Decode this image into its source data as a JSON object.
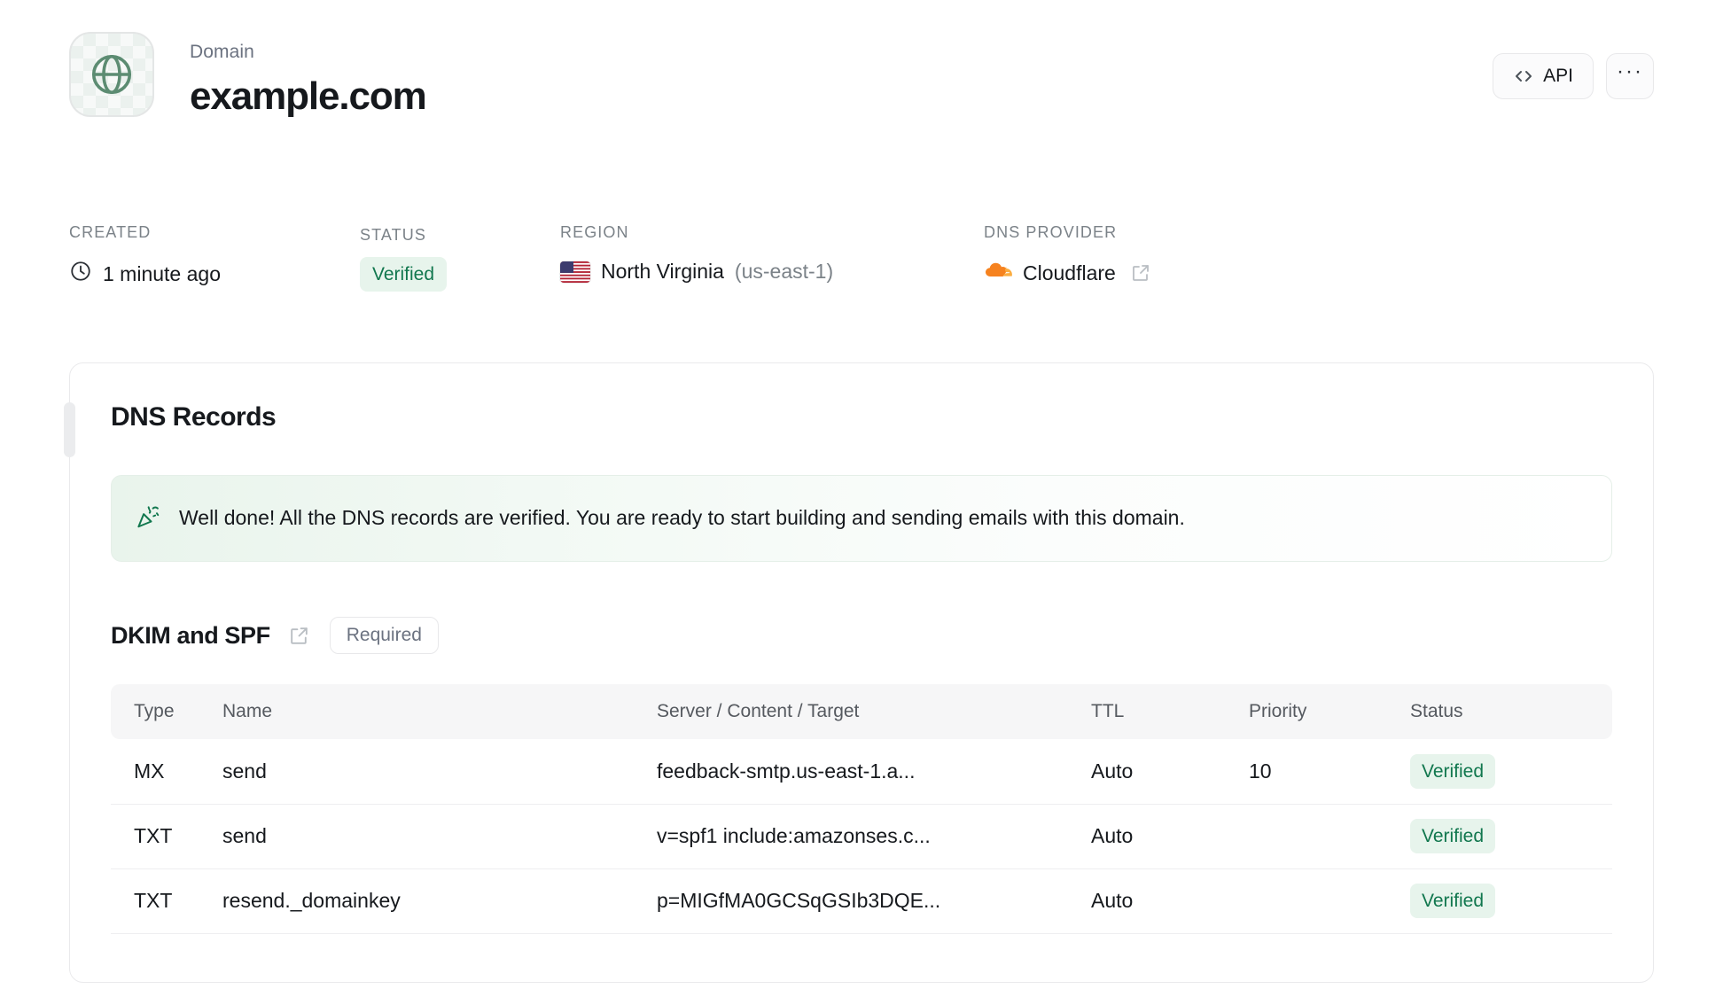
{
  "header": {
    "eyebrow": "Domain",
    "title": "example.com",
    "tile_icon": "globe-icon",
    "api_button": "API",
    "api_icon": "code-icon",
    "more_button": "···"
  },
  "meta": {
    "created": {
      "label": "CREATED",
      "icon": "clock-icon",
      "value": "1 minute ago"
    },
    "status": {
      "label": "STATUS",
      "value": "Verified"
    },
    "region": {
      "label": "REGION",
      "icon": "us-flag-icon",
      "value": "North Virginia",
      "code": "(us-east-1)"
    },
    "dns_provider": {
      "label": "DNS PROVIDER",
      "icon": "cloudflare-icon",
      "value": "Cloudflare",
      "link_icon": "external-link-icon"
    }
  },
  "card": {
    "title": "DNS Records",
    "notice": {
      "icon": "party-popper-icon",
      "text": "Well done! All the DNS records are verified. You are ready to start building and sending emails with this domain."
    },
    "section": {
      "title": "DKIM and SPF",
      "link_icon": "external-link-icon",
      "badge": "Required"
    },
    "table": {
      "columns": [
        "Type",
        "Name",
        "Server / Content / Target",
        "TTL",
        "Priority",
        "Status"
      ],
      "rows": [
        {
          "type": "MX",
          "name": "send",
          "target": "feedback-smtp.us-east-1.a...",
          "ttl": "Auto",
          "priority": "10",
          "status": "Verified"
        },
        {
          "type": "TXT",
          "name": "send",
          "target": "v=spf1 include:amazonses.c...",
          "ttl": "Auto",
          "priority": "",
          "status": "Verified"
        },
        {
          "type": "TXT",
          "name": "resend._domainkey",
          "target": "p=MIGfMA0GCSqGSIb3DQE...",
          "ttl": "Auto",
          "priority": "",
          "status": "Verified"
        }
      ]
    }
  },
  "colors": {
    "accent_green": "#11774e",
    "badge_bg": "#e7f4ec",
    "cloudflare_orange": "#f6821f",
    "globe_green": "#5c8c72",
    "text": "#16191d",
    "muted": "#7b8288"
  }
}
